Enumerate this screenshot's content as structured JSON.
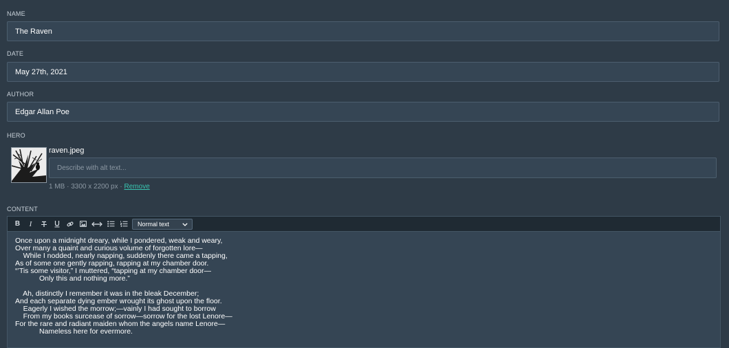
{
  "fields": {
    "name": {
      "label": "NAME",
      "value": "The Raven"
    },
    "date": {
      "label": "DATE",
      "value": "May 27th, 2021"
    },
    "author": {
      "label": "AUTHOR",
      "value": "Edgar Allan Poe"
    }
  },
  "hero": {
    "label": "HERO",
    "filename": "raven.jpeg",
    "alt_placeholder": "Describe with alt text...",
    "alt_value": "",
    "size": "1 MB",
    "dimensions": "3300 x 2200 px",
    "separator": " · ",
    "remove_label": "Remove"
  },
  "content": {
    "label": "CONTENT",
    "toolbar": {
      "buttons": [
        "bold-icon",
        "italic-icon",
        "strikethrough-icon",
        "underline-icon",
        "link-icon",
        "image-icon",
        "horizontal-rule-icon",
        "bullet-list-icon",
        "numbered-list-icon"
      ],
      "format_value": "Normal text"
    },
    "lines": [
      "Once upon a midnight dreary, while I pondered, weak and weary,",
      "Over many a quaint and curious volume of forgotten lore—",
      "    While I nodded, nearly napping, suddenly there came a tapping,",
      "As of some one gently rapping, rapping at my chamber door.",
      "“’Tis some visitor,” I muttered, “tapping at my chamber door—",
      "            Only this and nothing more.”",
      "",
      "    Ah, distinctly I remember it was in the bleak December;",
      "And each separate dying ember wrought its ghost upon the floor.",
      "    Eagerly I wished the morrow;—vainly I had sought to borrow",
      "    From my books surcease of sorrow—sorrow for the lost Lenore—",
      "For the rare and radiant maiden whom the angels name Lenore—",
      "            Nameless here for evermore."
    ]
  },
  "colors": {
    "background": "#2e3b47",
    "input_bg": "#354554",
    "toolbar_bg": "#1f2a33",
    "link": "#39c4b0"
  }
}
